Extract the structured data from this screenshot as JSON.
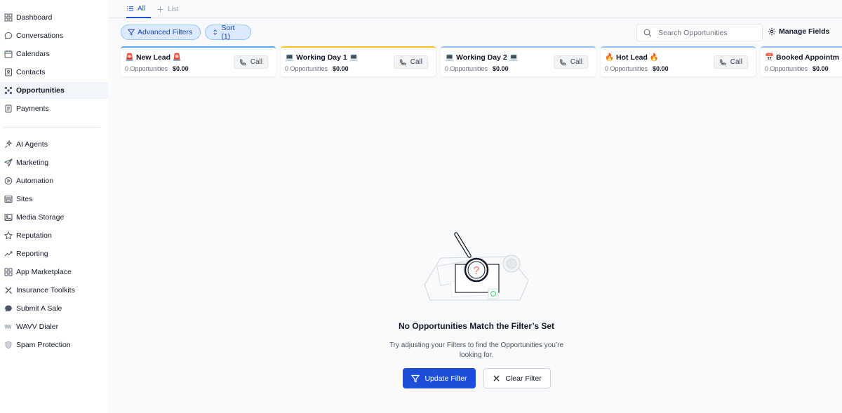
{
  "sidebar": {
    "items": [
      {
        "label": "Dashboard",
        "icon": "dashboard-grid-icon"
      },
      {
        "label": "Conversations",
        "icon": "chat-bubble-icon"
      },
      {
        "label": "Calendars",
        "icon": "calendar-icon"
      },
      {
        "label": "Contacts",
        "icon": "contact-card-icon"
      },
      {
        "label": "Opportunities",
        "icon": "pipeline-icon",
        "active": true
      },
      {
        "label": "Payments",
        "icon": "receipt-icon"
      },
      {
        "label": "AI Agents",
        "icon": "sparkle-icon"
      },
      {
        "label": "Marketing",
        "icon": "send-icon"
      },
      {
        "label": "Automation",
        "icon": "play-circle-icon"
      },
      {
        "label": "Sites",
        "icon": "browser-icon"
      },
      {
        "label": "Media Storage",
        "icon": "image-icon"
      },
      {
        "label": "Reputation",
        "icon": "star-icon"
      },
      {
        "label": "Reporting",
        "icon": "trend-icon"
      },
      {
        "label": "App Marketplace",
        "icon": "apps-grid-icon"
      },
      {
        "label": "Insurance Toolkits",
        "icon": "tools-icon"
      },
      {
        "label": "Submit A Sale",
        "icon": "chat-dot-icon"
      },
      {
        "label": "WAVV Dialer",
        "icon": "wavv-icon"
      },
      {
        "label": "Spam Protection",
        "icon": "shield-icon"
      }
    ]
  },
  "tabs": {
    "all": "All",
    "list": "List"
  },
  "toolbar": {
    "advanced_filters": "Advanced Filters",
    "sort": "Sort (1)",
    "search_placeholder": "Search Opportunities",
    "manage_fields": "Manage Fields"
  },
  "stages": [
    {
      "title": "🚨 New Lead 🚨",
      "count": "0 Opportunities",
      "value": "$0.00",
      "call": "Call",
      "accent": "#60a5fa"
    },
    {
      "title": "💻 Working Day 1 💻",
      "count": "0 Opportunities",
      "value": "$0.00",
      "call": "Call",
      "accent": "#fbbf24"
    },
    {
      "title": "💻 Working Day 2 💻",
      "count": "0 Opportunities",
      "value": "$0.00",
      "call": "Call",
      "accent": "#93c5fd"
    },
    {
      "title": "🔥 Hot Lead 🔥",
      "count": "0 Opportunities",
      "value": "$0.00",
      "call": "Call",
      "accent": "#93c5fd"
    },
    {
      "title": "📅 Booked Appointm",
      "count": "0 Opportunities",
      "value": "$0.00",
      "call": "Call",
      "accent": "#93c5fd"
    }
  ],
  "empty": {
    "title": "No Opportunities Match the Filter’s Set",
    "desc": "Try adjusting your Filters to find the Opportunities you’re looking for.",
    "update": "Update Filter",
    "clear": "Clear Filter"
  },
  "colors": {
    "primary": "#1d4ed8",
    "chip_bg": "#dbeafe",
    "active_nav_bg": "#f1f5f9"
  }
}
